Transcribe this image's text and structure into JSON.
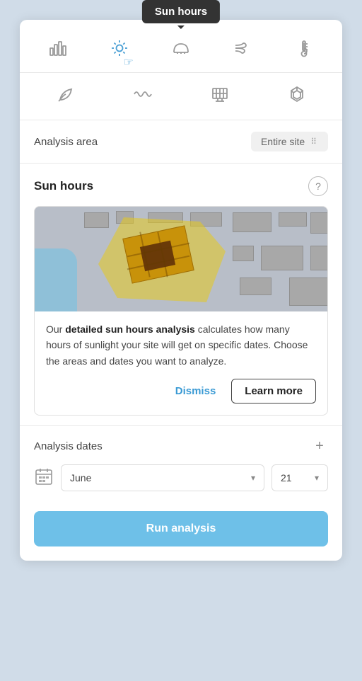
{
  "tooltip": {
    "label": "Sun hours"
  },
  "toolbar": {
    "row1": [
      {
        "id": "bar-chart",
        "label": "Bar chart icon",
        "active": false
      },
      {
        "id": "sun-hours",
        "label": "Sun hours icon",
        "active": true
      },
      {
        "id": "dome",
        "label": "Dome icon",
        "active": false
      },
      {
        "id": "wind",
        "label": "Wind icon",
        "active": false
      },
      {
        "id": "temperature",
        "label": "Temperature icon",
        "active": false
      }
    ],
    "row2": [
      {
        "id": "leaf",
        "label": "Leaf icon",
        "active": false
      },
      {
        "id": "wave",
        "label": "Wave icon",
        "active": false
      },
      {
        "id": "solar-panel",
        "label": "Solar panel icon",
        "active": false
      },
      {
        "id": "cube",
        "label": "Cube icon",
        "active": false
      }
    ]
  },
  "analysis_area": {
    "label": "Analysis area",
    "value": "Entire site"
  },
  "sun_hours": {
    "title": "Sun hours",
    "help_label": "?",
    "info_card": {
      "description_prefix": "Our ",
      "description_bold": "detailed sun hours analysis",
      "description_suffix": " calculates how many hours of sunlight your site will get on specific dates. Choose the areas and dates you want to analyze.",
      "dismiss_label": "Dismiss",
      "learn_more_label": "Learn more"
    }
  },
  "analysis_dates": {
    "title": "Analysis dates",
    "add_label": "+",
    "month_value": "June",
    "day_value": "21"
  },
  "run_analysis": {
    "label": "Run analysis"
  }
}
